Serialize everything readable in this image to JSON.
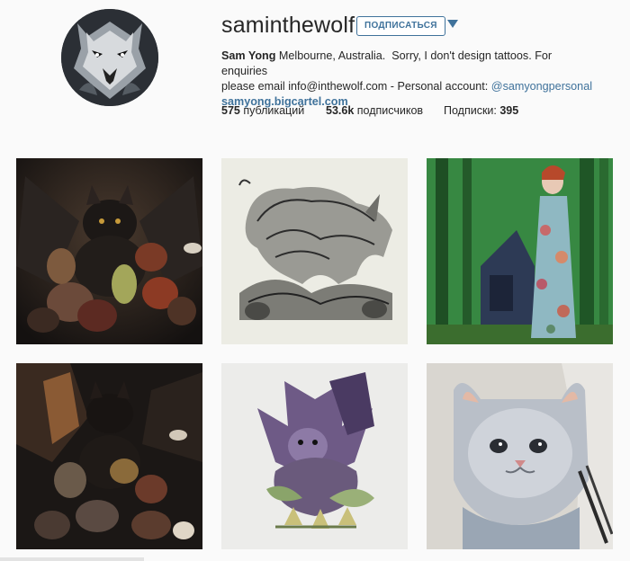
{
  "profile": {
    "username": "saminthewolf",
    "follow_label": "ПОДПИСАТЬСЯ",
    "more_icon": "triangle-down-icon",
    "avatar": "wolf-portrait"
  },
  "bio": {
    "full_name": "Sam Yong",
    "text_line1": " Melbourne, Australia. ‌‌ Sorry, I don't design tattoos. For enquiries",
    "text_line2": "please email info@inthewolf.com - Personal account: ",
    "personal_account": "@samyongpersonal",
    "website": "samyong.bigcartel.com"
  },
  "stats": {
    "posts_count": "575",
    "posts_label": " публикаций",
    "followers_count": "53.6k",
    "followers_label": " подписчиков",
    "following_label": "Подписки: ",
    "following_count": "395"
  },
  "posts": [
    {
      "subject": "bat-with-fruit-painting"
    },
    {
      "subject": "elephant-cats-ink-drawing"
    },
    {
      "subject": "girl-in-forest-painting"
    },
    {
      "subject": "bat-with-fruit-dark-painting"
    },
    {
      "subject": "purple-bat-illustration"
    },
    {
      "subject": "white-cat-painting"
    }
  ],
  "colors": {
    "link": "#3f729b",
    "text": "#262626",
    "background": "#fafafa"
  }
}
